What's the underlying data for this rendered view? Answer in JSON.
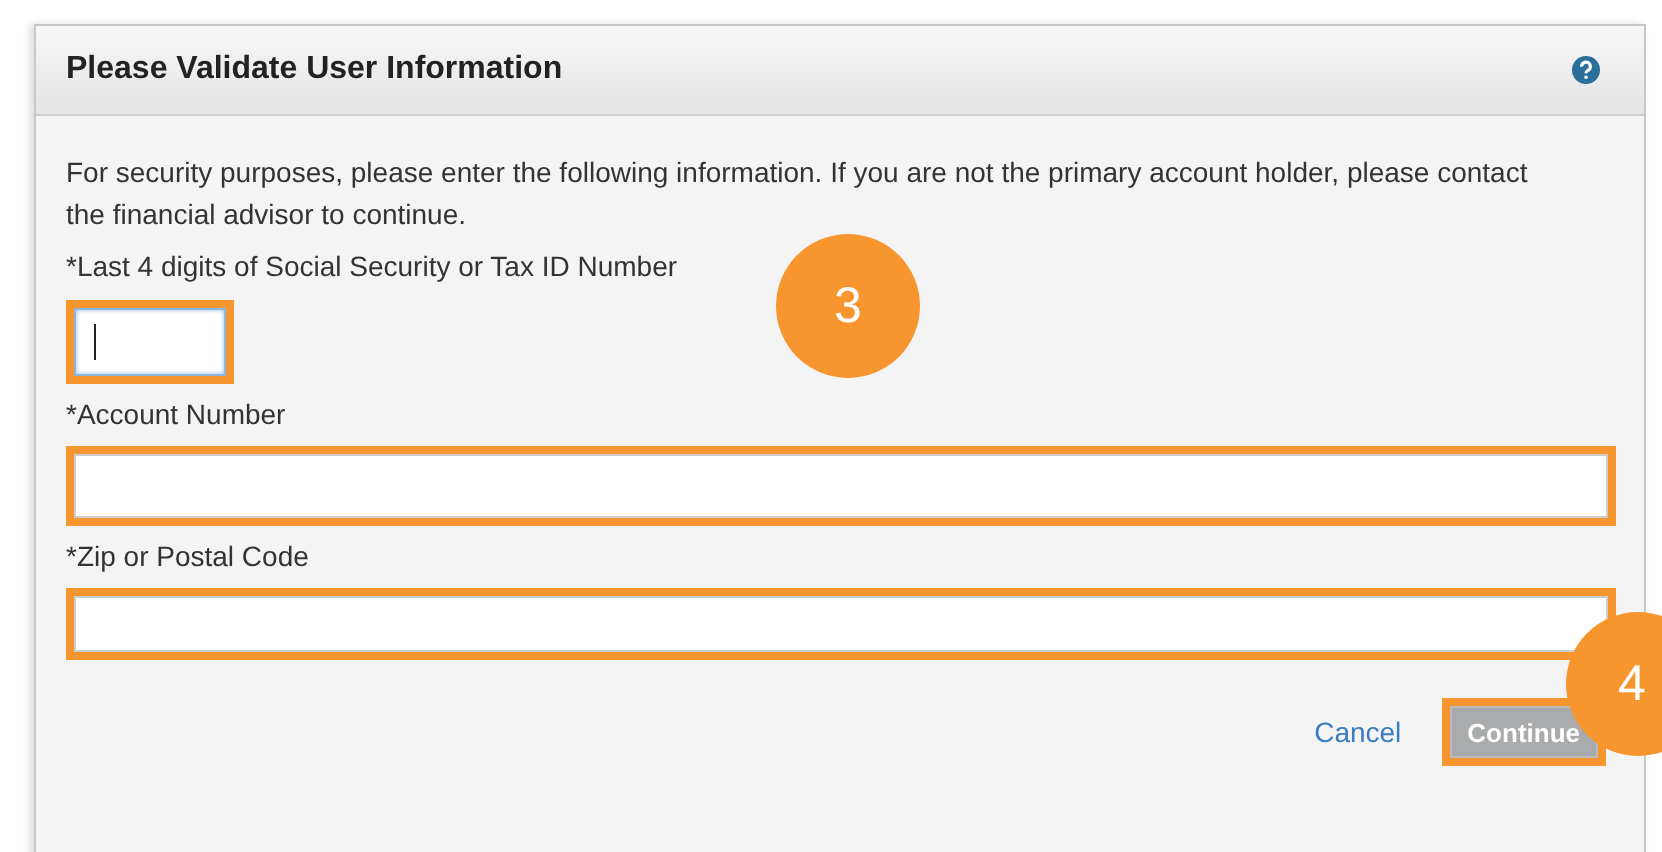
{
  "dialog": {
    "title": "Please Validate User Information",
    "intro": "For security purposes, please enter the following information. If you are not the primary account holder, please contact the financial advisor to continue.",
    "fields": [
      {
        "label": "*Last 4 digits of Social Security or Tax ID Number",
        "kind": "short",
        "focused": true,
        "highlighted": true
      },
      {
        "label": "*Account Number",
        "kind": "full",
        "focused": false,
        "highlighted": true
      },
      {
        "label": "*Zip or Postal Code",
        "kind": "full",
        "focused": false,
        "highlighted": true
      }
    ],
    "cancel": "Cancel",
    "continue": {
      "label": "Continue",
      "disabled": true,
      "highlighted": true
    }
  },
  "callouts": [
    {
      "number": "3"
    },
    {
      "number": "4"
    }
  ]
}
